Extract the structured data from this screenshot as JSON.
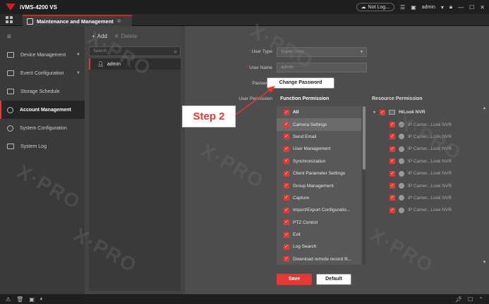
{
  "app": {
    "title": "iVMS-4200 VS"
  },
  "titlebar": {
    "status": "Not Log...",
    "user": "admin"
  },
  "tab": {
    "label": "Maintenance and Management"
  },
  "sidebar": {
    "items": [
      {
        "label": "Device Management"
      },
      {
        "label": "Event Configuration"
      },
      {
        "label": "Storage Schedule"
      },
      {
        "label": "Account Management"
      },
      {
        "label": "System Configuration"
      },
      {
        "label": "System Log"
      }
    ]
  },
  "userpanel": {
    "add_label": "Add",
    "delete_label": "Delete",
    "search_placeholder": "Search",
    "users": [
      "admin"
    ]
  },
  "form": {
    "user_type_label": "User Type",
    "user_type_value": "Super User",
    "user_name_label": "User Name",
    "user_name_value": "admin",
    "password_label": "Password",
    "change_password_label": "Change Password",
    "user_permission_label": "User Permission"
  },
  "function_permission": {
    "header": "Function Permission",
    "items": [
      "All",
      "Camera Settings",
      "Send Email",
      "User Management",
      "Synchronization",
      "Client Parameter Settings",
      "Group Management",
      "Capture",
      "Import/Export Configuratio...",
      "PTZ Control",
      "Exit",
      "Log Search",
      "Download remote record fil..."
    ]
  },
  "resource_permission": {
    "header": "Resource Permission",
    "root": "HiLook NVR",
    "cameras": [
      "IP Camer...Look NVR",
      "IP Camer...Look NVR",
      "IP Camer...Look NVR",
      "IP Camer...Look NVR",
      "IP Camer...Look NVR",
      "IP Camer...Look NVR",
      "IP Camer...Look NVR",
      "IP Camer...Look NVR"
    ]
  },
  "buttons": {
    "save": "Save",
    "default": "Default"
  },
  "annotation": {
    "step": "Step 2"
  },
  "colors": {
    "accent": "#e53935"
  }
}
